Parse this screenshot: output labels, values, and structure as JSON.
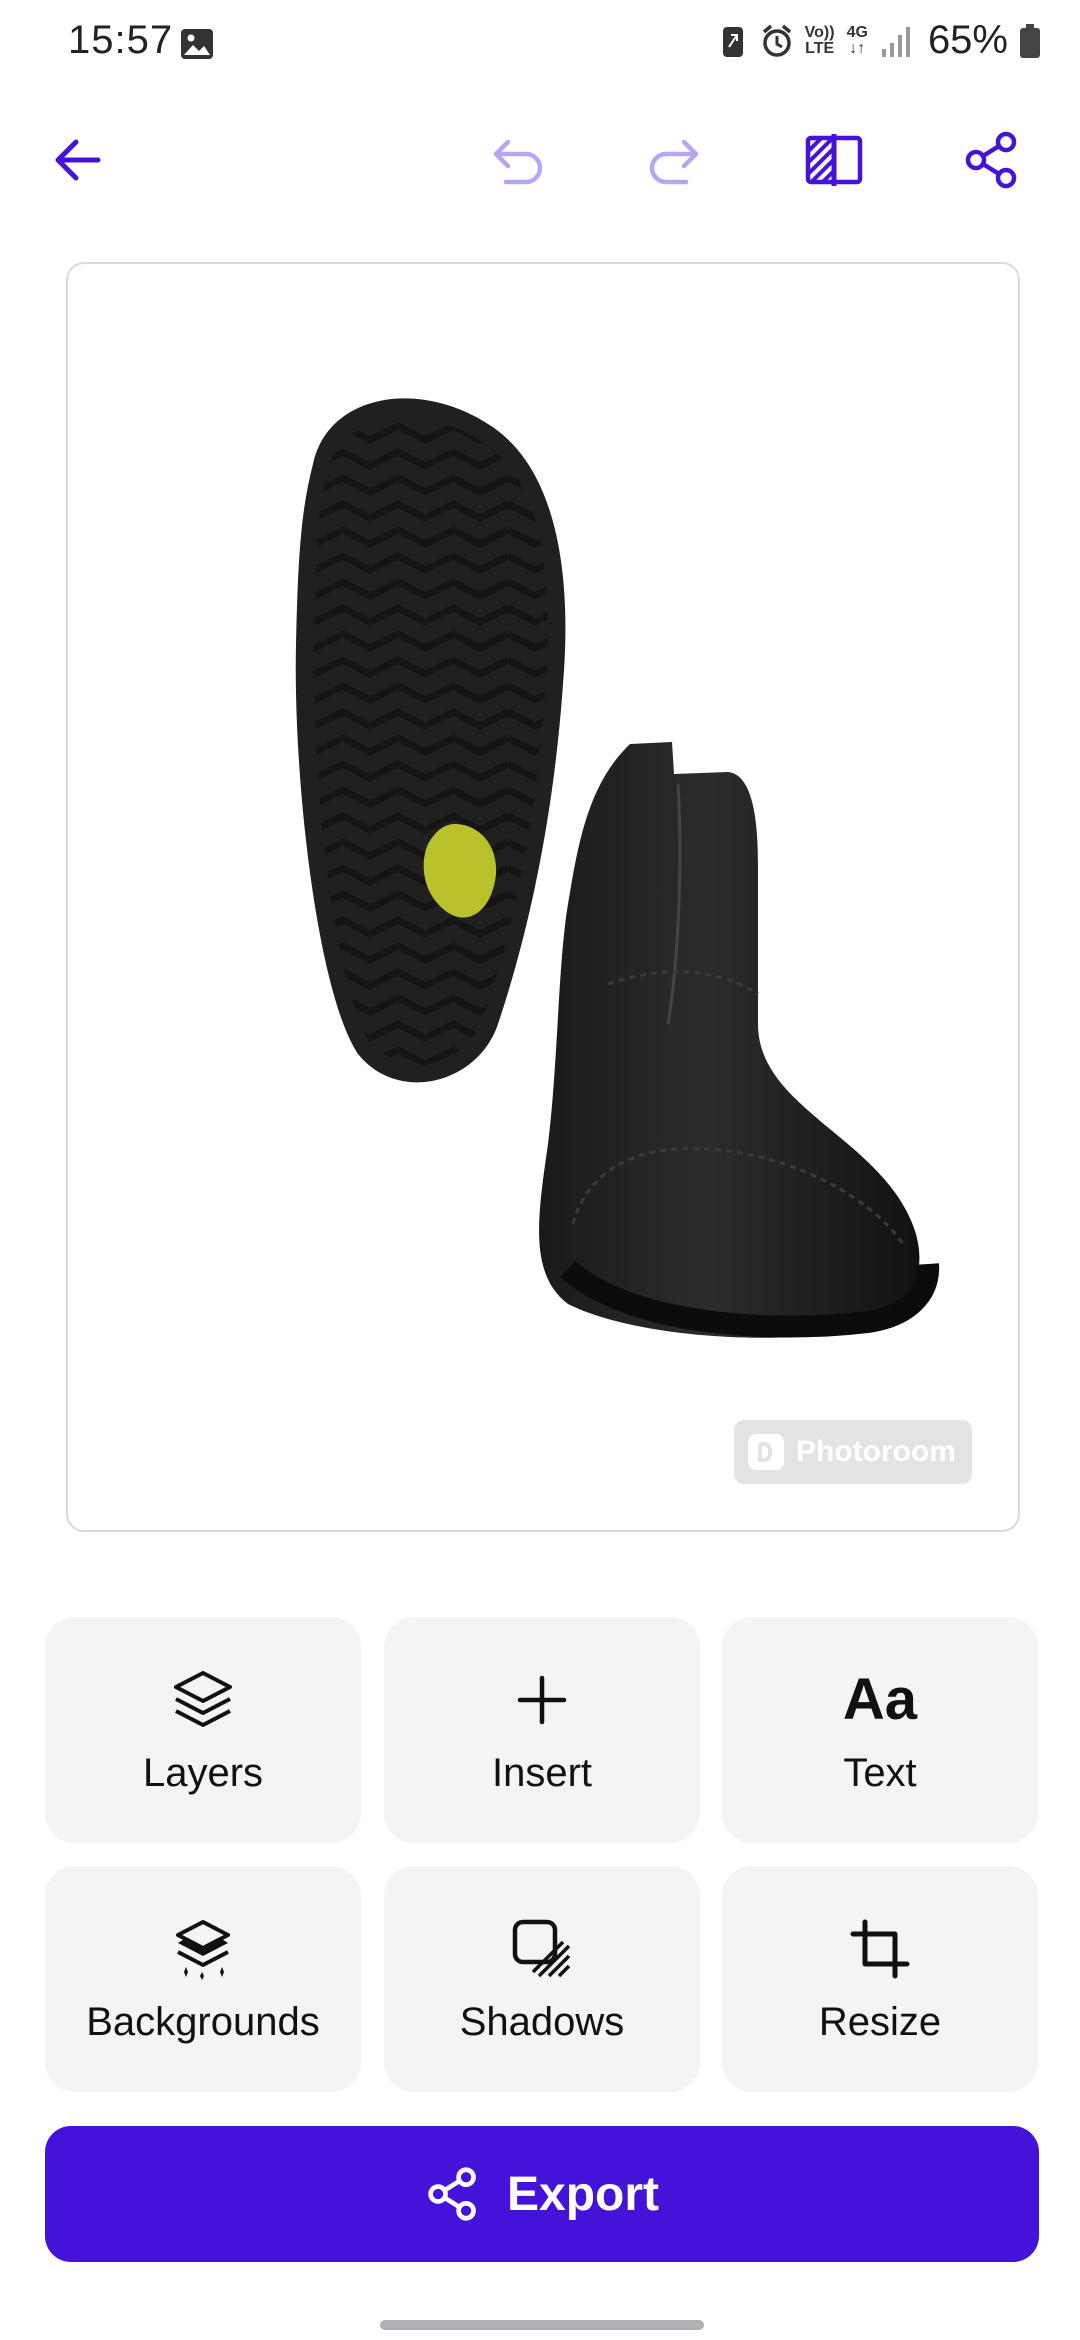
{
  "status_bar": {
    "time": "15:57",
    "volte_top": "Vo))",
    "volte_bottom": "LTE",
    "network": "4G",
    "battery_percent": "65%"
  },
  "toolbar": {
    "back": "arrow-left-icon",
    "undo": "undo-icon",
    "redo": "redo-icon",
    "compare": "compare-icon",
    "share": "share-icon"
  },
  "canvas": {
    "watermark_text": "Photoroom"
  },
  "tools": [
    {
      "label": "Layers",
      "icon": "layers-icon"
    },
    {
      "label": "Insert",
      "icon": "plus-icon"
    },
    {
      "label": "Text",
      "icon": "text-icon",
      "glyph": "Aa"
    },
    {
      "label": "Backgrounds",
      "icon": "backgrounds-icon"
    },
    {
      "label": "Shadows",
      "icon": "shadows-icon"
    },
    {
      "label": "Resize",
      "icon": "crop-icon"
    }
  ],
  "export": {
    "label": "Export"
  },
  "colors": {
    "accent": "#4512d9",
    "accent_light": "#b7a6f3",
    "tile_bg": "#f4f4f6"
  }
}
